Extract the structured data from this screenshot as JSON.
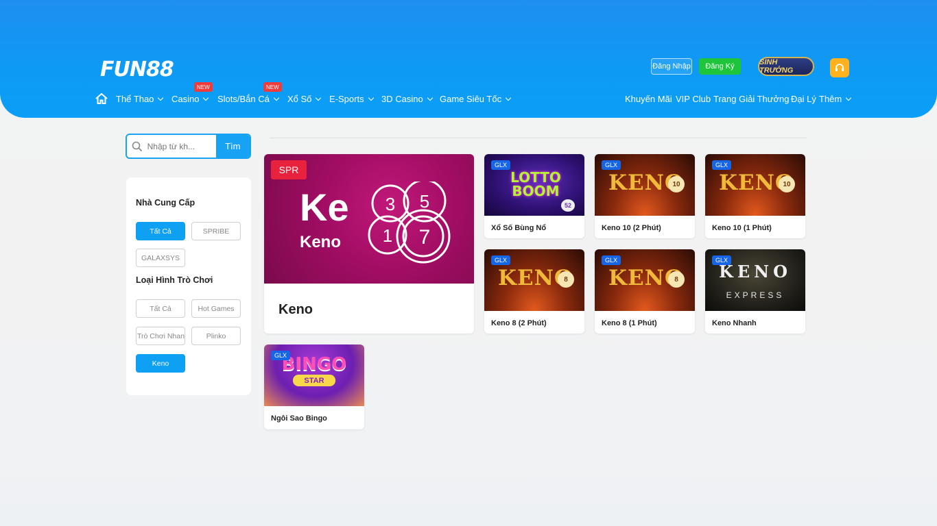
{
  "header": {
    "logo": "FUN88",
    "login_label": "Đăng Nhập",
    "register_label": "Đăng Ký",
    "rank_badge": "SINH TRƯỞNG",
    "nav_left": [
      {
        "label": "Thể Thao"
      },
      {
        "label": "Casino",
        "badge": "NEW"
      },
      {
        "label": "Slots/Bắn Cá",
        "badge": "NEW"
      },
      {
        "label": "Xổ Số"
      },
      {
        "label": "E-Sports"
      },
      {
        "label": "3D Casino"
      },
      {
        "label": "Game Siêu Tốc"
      }
    ],
    "nav_right": [
      {
        "label": "Khuyến Mãi"
      },
      {
        "label": "VIP Club"
      },
      {
        "label": "Trang Giải Thưởng"
      },
      {
        "label": "Đại Lý"
      },
      {
        "label": "Thêm"
      }
    ]
  },
  "search": {
    "placeholder": "Nhập từ kh...",
    "button": "Tìm"
  },
  "filters": {
    "provider_title": "Nhà Cung Cấp",
    "providers": [
      "Tất Cả",
      "SPRIBE",
      "GALAXSYS"
    ],
    "type_title": "Loại Hình Trò Chơi",
    "types": [
      "Tất Cả",
      "Hot Games",
      "Trò Chơi Nhanh",
      "Plinko",
      "Keno"
    ]
  },
  "featured": {
    "provider": "SPR",
    "art_big": "Ke",
    "art_small": "Keno",
    "title": "Keno",
    "balls": [
      "3",
      "5",
      "1",
      "7"
    ]
  },
  "games": [
    {
      "provider": "GLX",
      "title": "Xổ Số Bùng Nổ",
      "art": "LOTTO BOOM",
      "art_num": "52"
    },
    {
      "provider": "GLX",
      "title": "Keno 10 (2 Phút)",
      "art": "KENO",
      "art_num": "10"
    },
    {
      "provider": "GLX",
      "title": "Keno 10 (1 Phút)",
      "art": "KENO",
      "art_num": "10"
    },
    {
      "provider": "GLX",
      "title": "Keno 8 (2 Phút)",
      "art": "KENO",
      "art_num": "8"
    },
    {
      "provider": "GLX",
      "title": "Keno 8 (1 Phút)",
      "art": "KENO",
      "art_num": "8"
    },
    {
      "provider": "GLX",
      "title": "Keno Nhanh",
      "art": "KENO",
      "art_sub": "EXPRESS"
    },
    {
      "provider": "GLX",
      "title": "Ngôi Sao Bingo",
      "art": "BINGO",
      "art_sub": "STAR"
    }
  ],
  "colors": {
    "primary": "#0ea0f3",
    "register": "#1ec43a",
    "new_badge": "#ef3b3b",
    "spr_tag": "#e8213c",
    "glx_tag": "#1565e6"
  },
  "icons": [
    "home-icon",
    "search-icon",
    "headset-icon",
    "chevron-down-icon"
  ]
}
